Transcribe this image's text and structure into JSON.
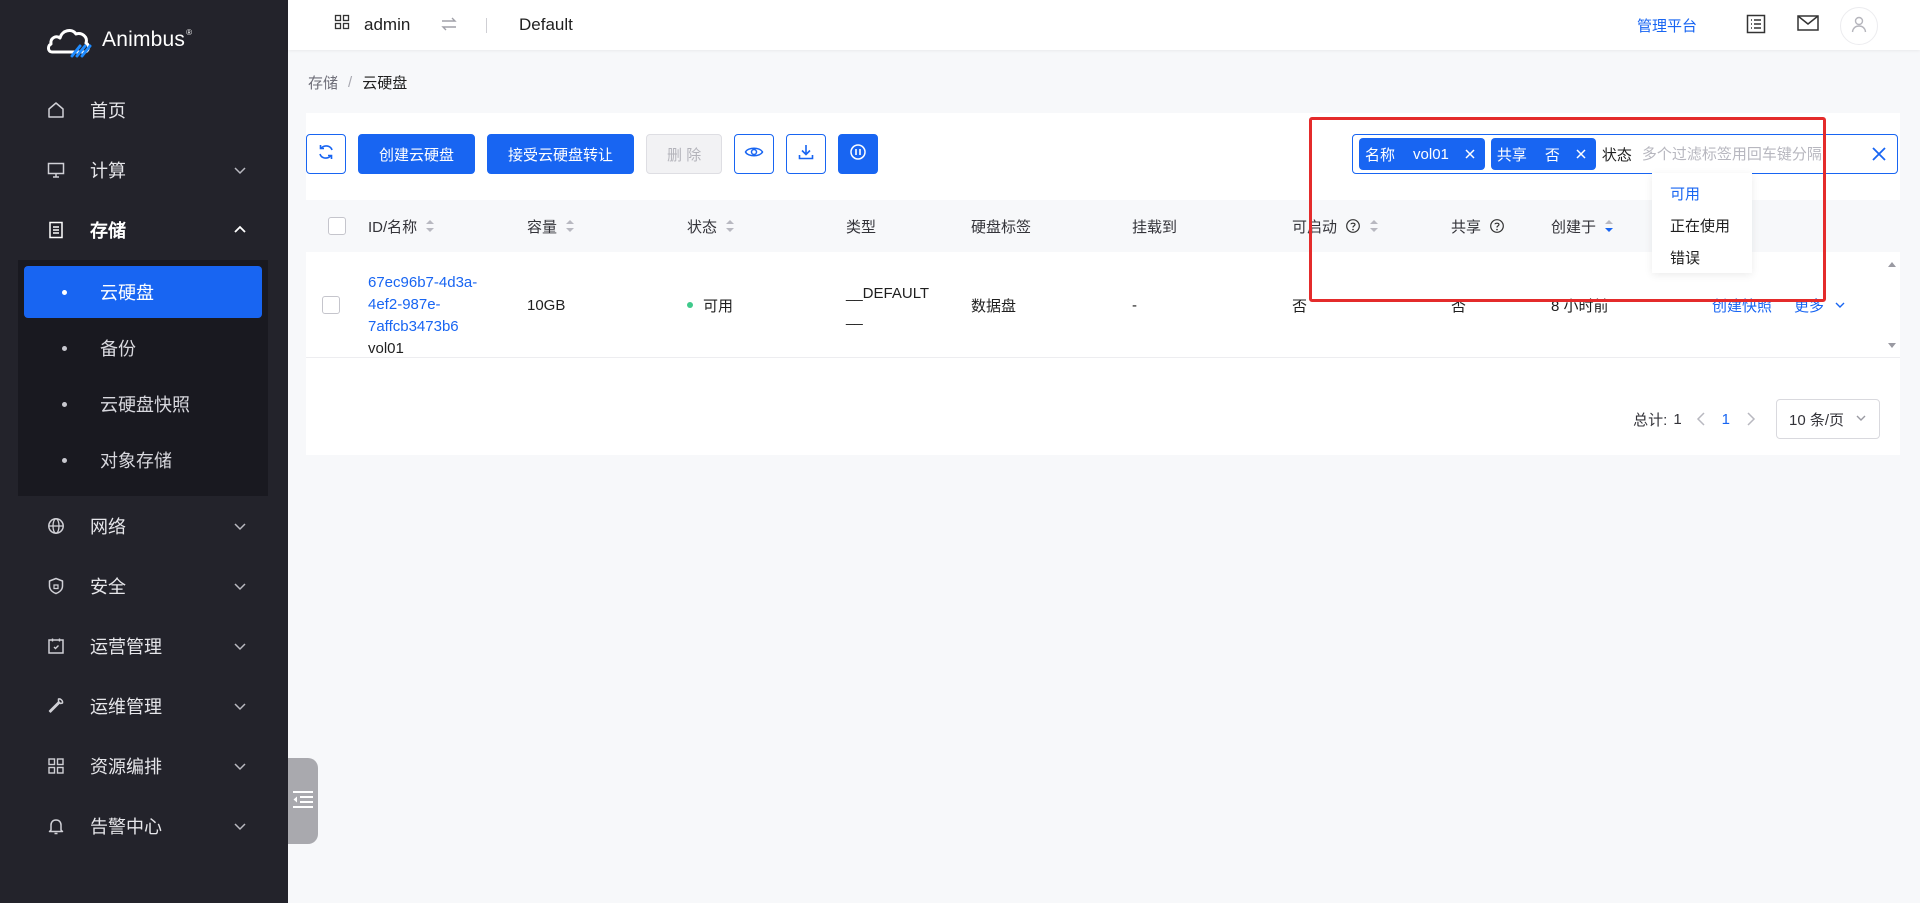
{
  "brand": {
    "name": "Animbus",
    "mark": "®"
  },
  "sidebar": {
    "items": [
      {
        "label": "首页",
        "icon": "home-icon"
      },
      {
        "label": "计算",
        "icon": "monitor-icon"
      },
      {
        "label": "存储",
        "icon": "storage-icon"
      },
      {
        "label": "网络",
        "icon": "globe-icon"
      },
      {
        "label": "安全",
        "icon": "shield-icon"
      },
      {
        "label": "运营管理",
        "icon": "calendar-icon"
      },
      {
        "label": "运维管理",
        "icon": "wrench-icon"
      },
      {
        "label": "资源编排",
        "icon": "apps-icon"
      },
      {
        "label": "告警中心",
        "icon": "bell-icon"
      }
    ],
    "storage_sub": [
      {
        "label": "云硬盘",
        "active": true
      },
      {
        "label": "备份"
      },
      {
        "label": "云硬盘快照"
      },
      {
        "label": "对象存储"
      }
    ]
  },
  "header": {
    "user": "admin",
    "project": "Default",
    "admin_link": "管理平台"
  },
  "breadcrumb": {
    "parent": "存储",
    "separator": "/",
    "current": "云硬盘"
  },
  "toolbar": {
    "create": "创建云硬盘",
    "accept_transfer": "接受云硬盘转让",
    "delete": "删 除"
  },
  "search": {
    "tags": [
      {
        "key": "名称",
        "value": "vol01"
      },
      {
        "key": "共享",
        "value": "否"
      }
    ],
    "prefix": "状态",
    "placeholder": "多个过滤标签用回车键分隔",
    "value": "",
    "dropdown": [
      "可用",
      "正在使用",
      "错误"
    ]
  },
  "table": {
    "columns": {
      "id_name": "ID/名称",
      "size": "容量",
      "status": "状态",
      "type": "类型",
      "tag": "硬盘标签",
      "attached": "挂载到",
      "bootable": "可启动",
      "shared": "共享",
      "created": "创建于"
    },
    "rows": [
      {
        "id_line1": "67ec96b7-4d3a-",
        "id_line2": "4ef2-987e-",
        "id_line3": "7affcb3473b6",
        "name": "vol01",
        "size": "10GB",
        "status": "可用",
        "type_line1": "__DEFAULT",
        "type_line2": "__",
        "tag": "数据盘",
        "attached": "-",
        "bootable": "否",
        "shared": "否",
        "created": "8 小时前",
        "action_snapshot": "创建快照",
        "action_more": "更多"
      }
    ]
  },
  "pagination": {
    "total_label": "总计:",
    "total": "1",
    "current_page": "1",
    "page_size": "10 条/页"
  },
  "colors": {
    "primary": "#1865f2",
    "sidebar_bg": "#23232b",
    "status_available": "#3fc98b",
    "highlight": "#e42b2b"
  }
}
